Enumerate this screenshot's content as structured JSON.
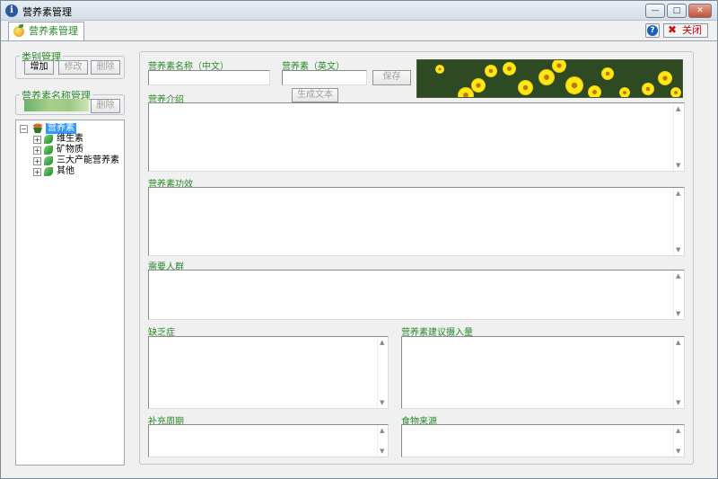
{
  "window": {
    "title": "营养素管理",
    "min": "—",
    "max": "□",
    "close": "✕"
  },
  "tab": {
    "label": "营养素管理"
  },
  "toolbar": {
    "help": "?",
    "close_label": "关闭"
  },
  "category_group": {
    "title": "类别管理",
    "add": "增加",
    "edit": "修改",
    "delete": "删除"
  },
  "name_group": {
    "title": "营养素名称管理",
    "delete": "删除"
  },
  "tree": {
    "root": "营养素",
    "children": [
      "维生素",
      "矿物质",
      "三大产能营养素",
      "其他"
    ]
  },
  "form": {
    "name_cn_label": "营养素名称（中文）",
    "name_en_label": "营养素（英文）",
    "name_cn_value": "",
    "name_en_value": "",
    "save": "保存",
    "generate": "生成文本",
    "intro_label": "营养介绍",
    "effect_label": "营养素功效",
    "people_label": "需要人群",
    "deficiency_label": "缺乏症",
    "intake_label": "营养素建议摄入量",
    "period_label": "补充周期",
    "source_label": "食物来源"
  },
  "colors": {
    "label_green": "#2a8a2a",
    "selection": "#3399ff"
  }
}
